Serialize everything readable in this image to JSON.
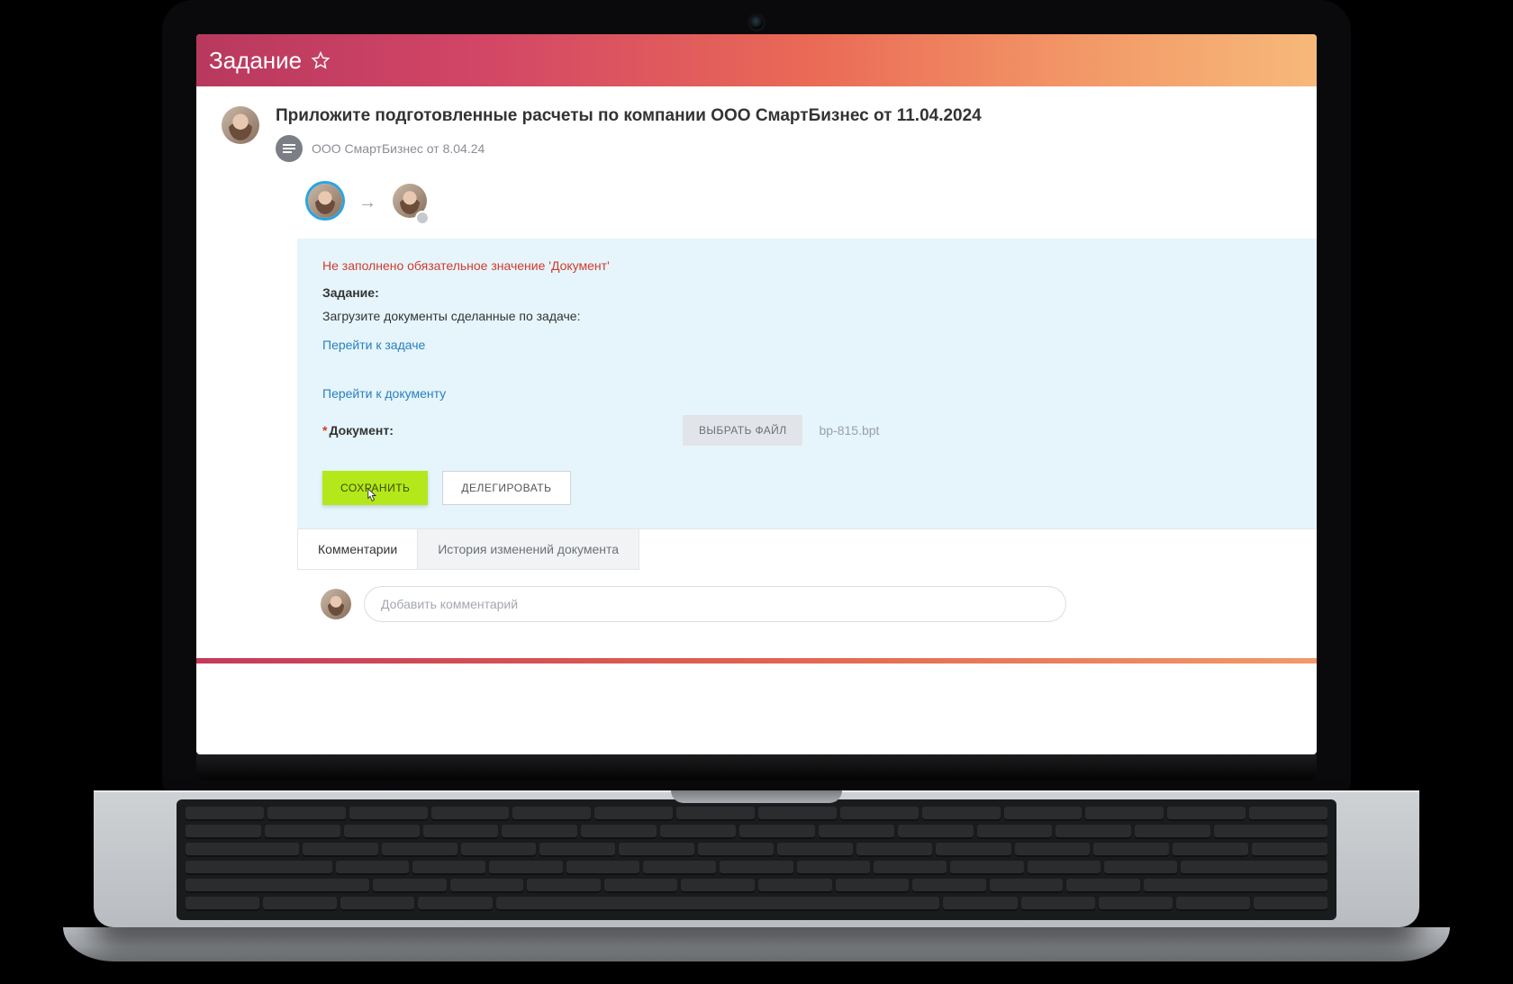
{
  "header": {
    "title": "Задание"
  },
  "task": {
    "title": "Приложите подготовленные расчеты по компании ООО СмартБизнес от 11.04.2024",
    "company": "ООО СмартБизнес от 8.04.24"
  },
  "panel": {
    "error": "Не заполнено обязательное значение 'Документ'",
    "section_label": "Задание:",
    "instruction": "Загрузите документы сделанные по задаче:",
    "link_task": "Перейти к задаче",
    "link_doc": "Перейти к документу",
    "doc_label": "Документ:",
    "file_button": "ВЫБРАТЬ ФАЙЛ",
    "file_name": "bp-815.bpt",
    "save": "СОХРАНИТЬ",
    "delegate": "ДЕЛЕГИРОВАТЬ"
  },
  "tabs": {
    "comments": "Комментарии",
    "history": "История изменений документа"
  },
  "comment": {
    "placeholder": "Добавить комментарий"
  }
}
